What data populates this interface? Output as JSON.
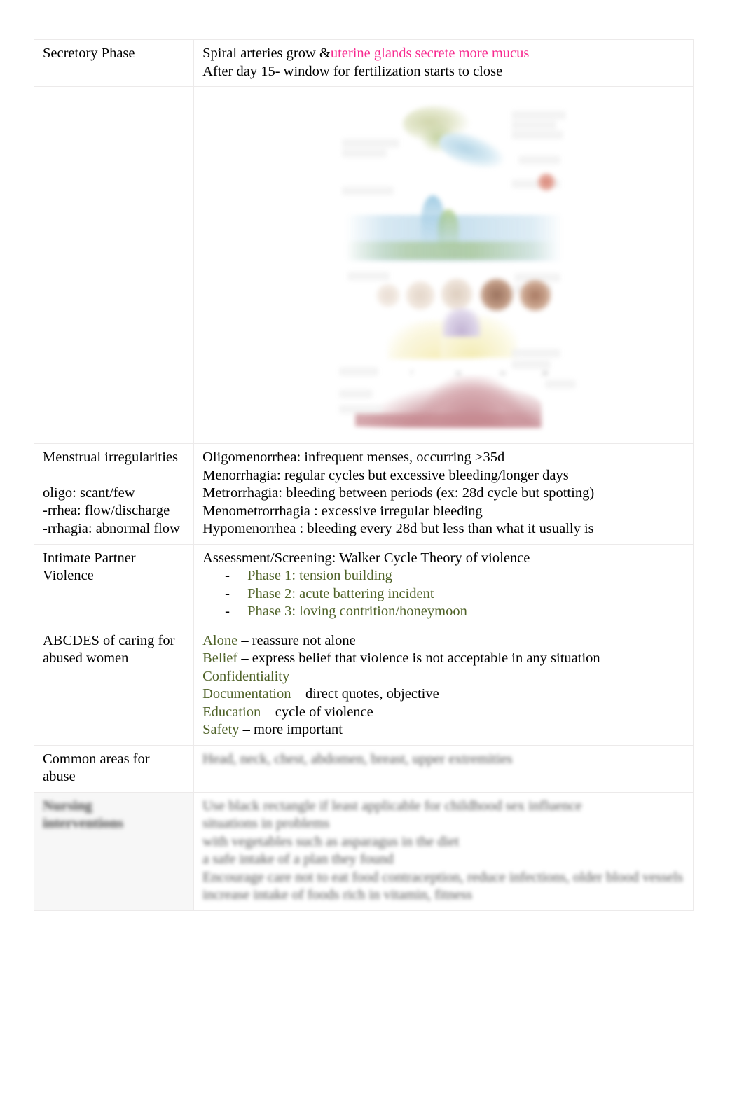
{
  "document": {
    "type": "study-notes-table",
    "colors": {
      "pink_highlight": "#f72a8f",
      "green_term": "#4f6228",
      "text": "#000000",
      "border": "#eceaea",
      "page_background": "#ffffff"
    }
  },
  "rows": [
    {
      "id": "secretory-phase",
      "label": "Secretory Phase",
      "lines": [
        {
          "prefix": "Spiral arteries grow &",
          "emphasis": "uterine glands secrete more mucus",
          "emphasis_color": "pink"
        },
        {
          "prefix": "After day 15- window for fertilization starts to close",
          "emphasis": "",
          "emphasis_color": "none"
        }
      ]
    },
    {
      "id": "cycle-figure",
      "label": "",
      "figure": {
        "name": "menstrual-cycle-diagram",
        "description": "Blurred diagram of the menstrual cycle: hypothalamus/pituitary hormones, FSH and LH curves, ovarian follicle development, ovulation, corpus luteum, estrogen and progesterone levels, day scale, and endometrial thickness curve.",
        "day_ticks": [
          "0",
          "7",
          "14",
          "21",
          "28"
        ]
      }
    },
    {
      "id": "menstrual-irregularities",
      "label": "Menstrual irregularities",
      "label_extra": [
        "oligo: scant/few",
        "-rrhea: flow/discharge",
        "-rrhagia: abnormal flow"
      ],
      "terms": [
        {
          "term": "Oligomenorrhea",
          "sep": ": ",
          "definition": "infrequent menses, occurring >35d"
        },
        {
          "term": "Menorrhagia",
          "sep": ": ",
          "definition": "regular cycles but excessive bleeding/longer days"
        },
        {
          "term": "Metrorrhagia",
          "sep": ": ",
          "definition": "bleeding between periods (ex: 28d cycle but spotting)"
        },
        {
          "term": "Menometrorrhagia",
          "sep": " : ",
          "definition": "excessive irregular bleeding"
        },
        {
          "term": "Hypomenorrhea",
          "sep": " : ",
          "definition": "bleeding every 28d but less than what it usually is"
        }
      ]
    },
    {
      "id": "intimate-partner-violence",
      "label_line1": "Intimate Partner",
      "label_line2": "Violence",
      "heading": "Assessment/Screening: Walker Cycle Theory of violence",
      "phases": [
        {
          "dash": "-",
          "name": "Phase 1",
          "sep": ": ",
          "text": "tension building"
        },
        {
          "dash": "-",
          "name": "Phase 2",
          "sep": ": ",
          "text": "acute battering incident"
        },
        {
          "dash": "-",
          "name": "Phase 3",
          "sep": ": ",
          "text": "loving contrition/honeymoon"
        }
      ]
    },
    {
      "id": "abcdes",
      "label_line1": "ABCDES of caring for",
      "label_line2": "abused women",
      "items": [
        {
          "key": "Alone",
          "rest": " – reassure not alone"
        },
        {
          "key": "Belief",
          "rest": " – express belief that violence is not acceptable in any situation"
        },
        {
          "key": "Confidentiality",
          "rest": ""
        },
        {
          "key": "Documentation",
          "rest": "  – direct quotes, objective"
        },
        {
          "key": "Education",
          "rest": " – cycle of violence"
        },
        {
          "key": "Safety",
          "rest": " – more important"
        }
      ]
    },
    {
      "id": "common-areas-for-abuse",
      "label_line1": "Common areas for",
      "label_line2": "abuse",
      "body_obscured": "Head, neck, chest, abdomen, breast, upper extremities"
    },
    {
      "id": "obscured-row",
      "label_obscured_line1": "Nursing",
      "label_obscured_line2": "interventions",
      "body_obscured_lines": [
        "Use black rectangle if least applicable for childhood sex influence",
        "situations in problems",
        "with vegetables such as asparagus in the diet",
        "a safe intake of a plan they found",
        "Encourage care not to eat food contraception, reduce infections, older blood vessels",
        "increase intake of foods rich in vitamin, fitness"
      ]
    }
  ]
}
